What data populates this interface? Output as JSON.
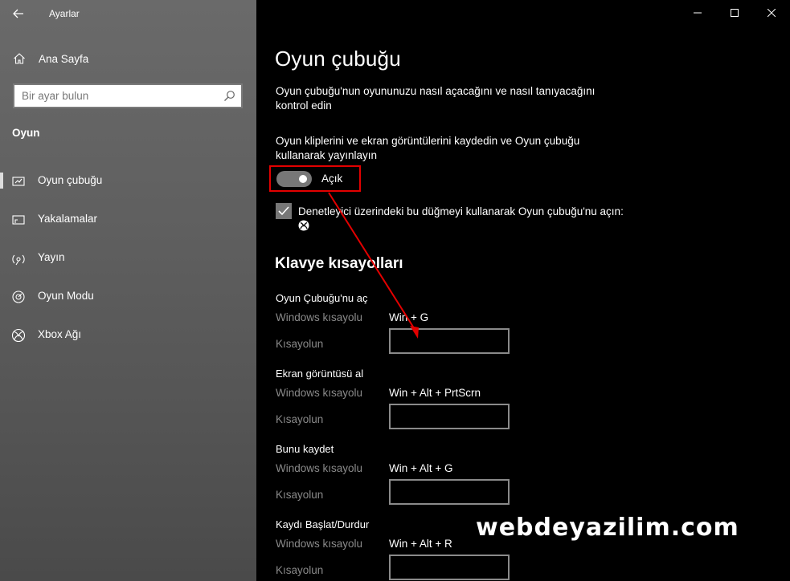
{
  "window": {
    "app_title": "Ayarlar"
  },
  "sidebar": {
    "home_label": "Ana Sayfa",
    "search_placeholder": "Bir ayar bulun",
    "section": "Oyun",
    "items": [
      {
        "label": "Oyun çubuğu",
        "icon": "game-bar-icon",
        "selected": true
      },
      {
        "label": "Yakalamalar",
        "icon": "captures-icon",
        "selected": false
      },
      {
        "label": "Yayın",
        "icon": "broadcast-icon",
        "selected": false
      },
      {
        "label": "Oyun Modu",
        "icon": "game-mode-icon",
        "selected": false
      },
      {
        "label": "Xbox Ağı",
        "icon": "xbox-icon",
        "selected": false
      }
    ]
  },
  "main": {
    "title": "Oyun çubuğu",
    "description": "Oyun çubuğu'nun oyununuzu nasıl açacağını ve nasıl tanıyacağını kontrol edin",
    "record_description": "Oyun kliplerini ve ekran görüntülerini kaydedin ve Oyun çubuğu kullanarak yayınlayın",
    "toggle_label": "Açık",
    "toggle_on": true,
    "checkbox_label": "Denetleyici üzerindeki bu düğmeyi kullanarak Oyun çubuğu'nu açın:",
    "checkbox_checked": true,
    "shortcuts_heading": "Klavye kısayolları",
    "shortcuts": [
      {
        "title": "Oyun Çubuğu'nu aç",
        "windows_label": "Windows kısayolu",
        "windows_value": "Win + G",
        "custom_label": "Kısayolun",
        "custom_value": ""
      },
      {
        "title": "Ekran görüntüsü al",
        "windows_label": "Windows kısayolu",
        "windows_value": "Win + Alt + PrtScrn",
        "custom_label": "Kısayolun",
        "custom_value": ""
      },
      {
        "title": "Bunu kaydet",
        "windows_label": "Windows kısayolu",
        "windows_value": "Win + Alt + G",
        "custom_label": "Kısayolun",
        "custom_value": ""
      },
      {
        "title": "Kaydı Başlat/Durdur",
        "windows_label": "Windows kısayolu",
        "windows_value": "Win + Alt + R",
        "custom_label": "Kısayolun",
        "custom_value": ""
      }
    ]
  },
  "watermark": "webdeyazilim.com",
  "colors": {
    "highlight": "#e30000",
    "sidebar_bg": "#5f5f5f",
    "main_bg": "#000000"
  }
}
